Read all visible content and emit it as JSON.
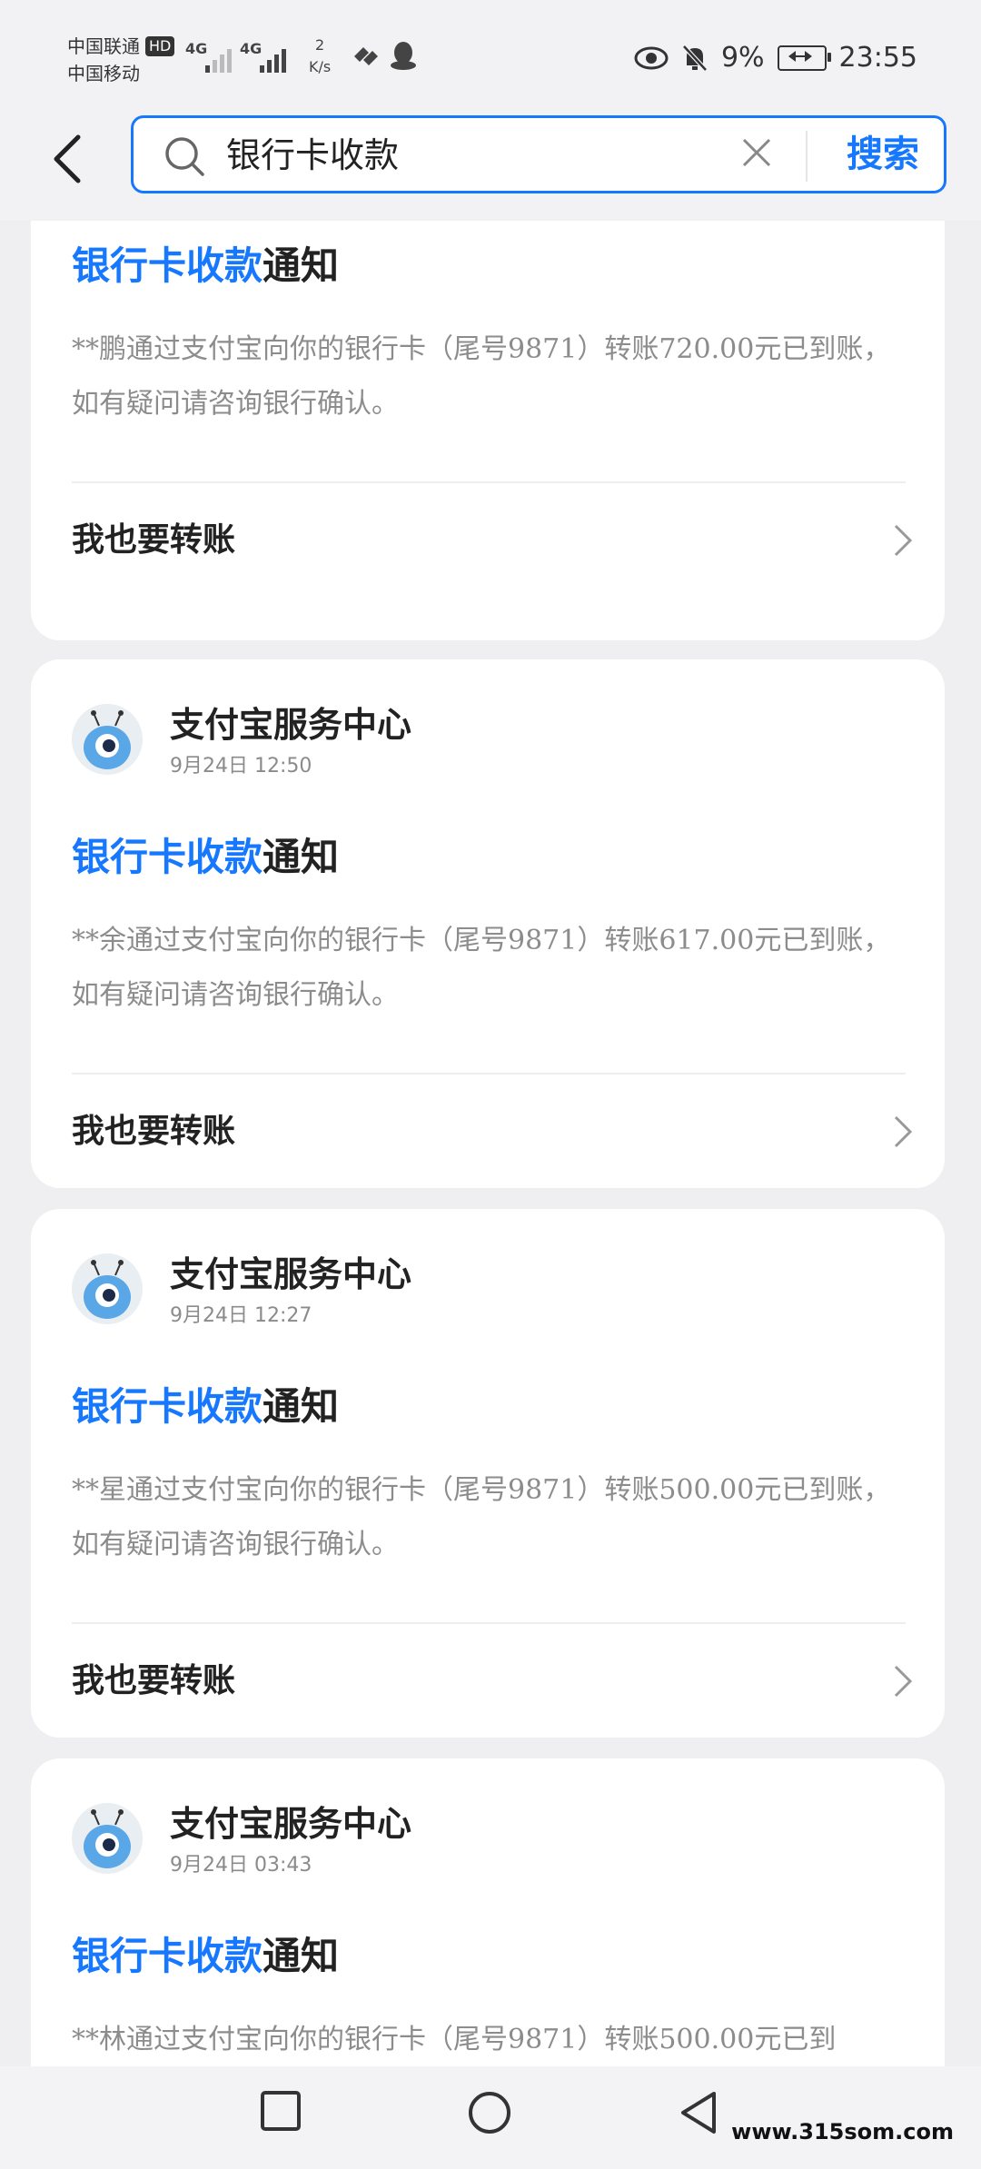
{
  "status_bar": {
    "carrier_1": "中国联通",
    "carrier_2": "中国移动",
    "hd_badge": "HD",
    "net_1": "4G",
    "net_2": "4G",
    "speed_value": "2",
    "speed_unit": "K/s",
    "battery": "9%",
    "time": "23:55",
    "icons": [
      "eye-icon",
      "bell-off-icon",
      "battery-icon",
      "heart-app-icon",
      "qq-penguin-icon"
    ]
  },
  "search": {
    "value": "银行卡收款",
    "button": "搜索"
  },
  "cards": [
    {
      "title_highlight": "银行卡收款",
      "title_rest": "通知",
      "body": "**鹏通过支付宝向你的银行卡（尾号9871）转账720.00元已到账， 如有疑问请咨询银行确认。",
      "action": "我也要转账"
    },
    {
      "sender": "支付宝服务中心",
      "time": "9月24日  12:50",
      "title_highlight": "银行卡收款",
      "title_rest": "通知",
      "body": "**余通过支付宝向你的银行卡（尾号9871）转账617.00元已到账， 如有疑问请咨询银行确认。",
      "action": "我也要转账"
    },
    {
      "sender": "支付宝服务中心",
      "time": "9月24日  12:27",
      "title_highlight": "银行卡收款",
      "title_rest": "通知",
      "body": "**星通过支付宝向你的银行卡（尾号9871）转账500.00元已到账， 如有疑问请咨询银行确认。",
      "action": "我也要转账"
    },
    {
      "sender": "支付宝服务中心",
      "time": "9月24日  03:43",
      "title_highlight": "银行卡收款",
      "title_rest": "通知",
      "body": "**林通过支付宝向你的银行卡（尾号9871）转账500.00元已到",
      "action": ""
    }
  ],
  "watermark": "www.315som.com",
  "colors": {
    "accent": "#1677ff",
    "background": "#efeff1"
  }
}
